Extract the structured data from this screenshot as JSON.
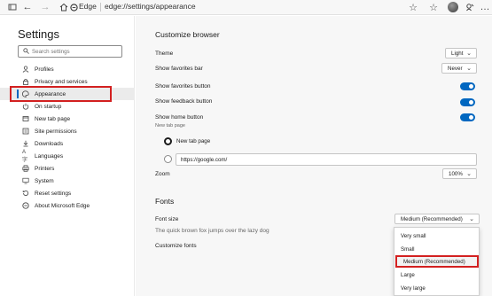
{
  "browser": {
    "brand": "Edge",
    "url": "edge://settings/appearance"
  },
  "sidebar": {
    "title": "Settings",
    "search_placeholder": "Search settings",
    "items": [
      {
        "label": "Profiles",
        "icon": "profile-icon"
      },
      {
        "label": "Privacy and services",
        "icon": "lock-icon"
      },
      {
        "label": "Appearance",
        "icon": "palette-icon",
        "active": true
      },
      {
        "label": "On startup",
        "icon": "power-icon"
      },
      {
        "label": "New tab page",
        "icon": "new-tab-icon"
      },
      {
        "label": "Site permissions",
        "icon": "site-permissions-icon"
      },
      {
        "label": "Downloads",
        "icon": "download-icon"
      },
      {
        "label": "Languages",
        "icon": "languages-icon"
      },
      {
        "label": "Printers",
        "icon": "printer-icon"
      },
      {
        "label": "System",
        "icon": "system-icon"
      },
      {
        "label": "Reset settings",
        "icon": "reset-icon"
      },
      {
        "label": "About Microsoft Edge",
        "icon": "edge-logo-icon"
      }
    ]
  },
  "customize": {
    "title": "Customize browser",
    "theme_label": "Theme",
    "theme_value": "Light",
    "favorites_bar_label": "Show favorites bar",
    "favorites_bar_value": "Never",
    "favorites_button_label": "Show favorites button",
    "feedback_button_label": "Show feedback button",
    "home_button_label": "Show home button",
    "home_button_sub": "New tab page",
    "radio_new_tab": "New tab page",
    "url_value": "https://google.com/",
    "zoom_label": "Zoom",
    "zoom_value": "100%"
  },
  "fonts": {
    "title": "Fonts",
    "font_size_label": "Font size",
    "font_size_value": "Medium (Recommended)",
    "preview": "The quick brown fox jumps over the lazy dog",
    "customize_label": "Customize fonts",
    "options": [
      "Very small",
      "Small",
      "Medium (Recommended)",
      "Large",
      "Very large"
    ],
    "selected_option": "Medium (Recommended)"
  },
  "colors": {
    "accent": "#0067c0",
    "highlight": "#d32020",
    "main_bg": "#f7f7f7"
  }
}
